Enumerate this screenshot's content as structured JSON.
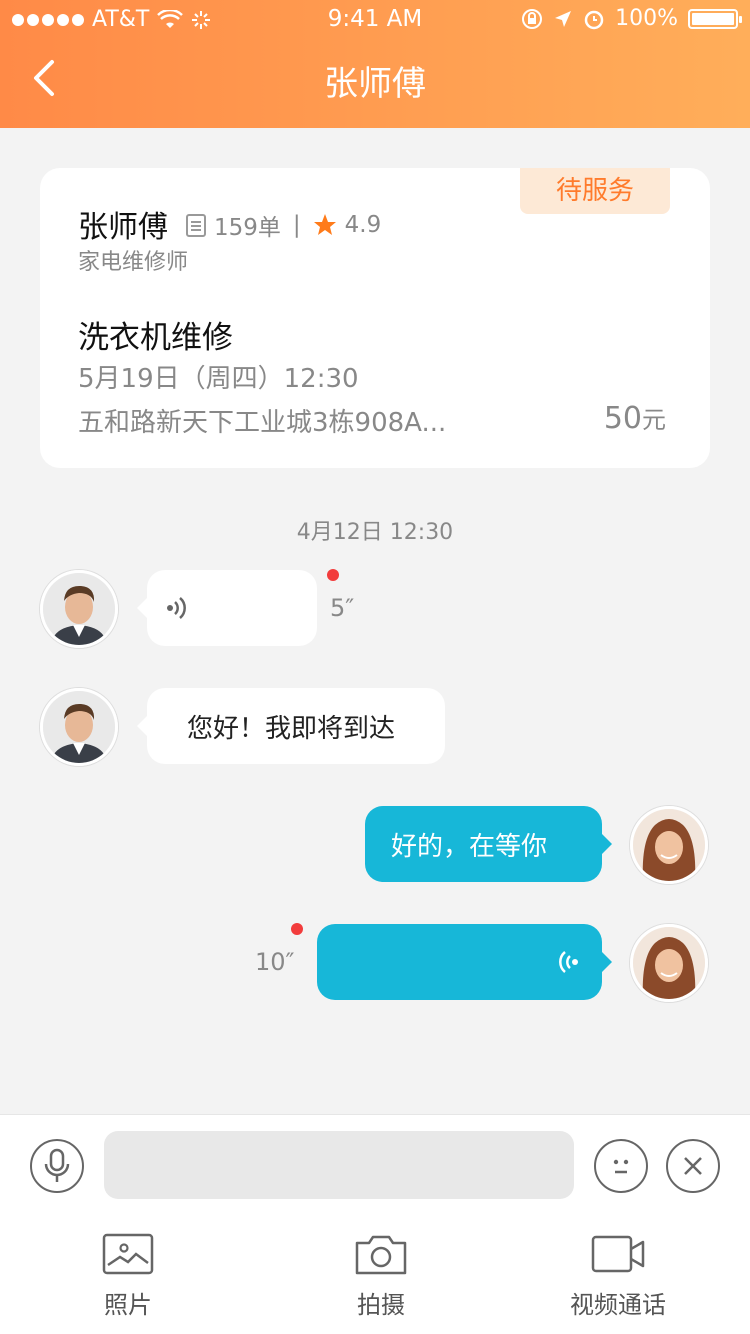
{
  "status_bar": {
    "carrier": "AT&T",
    "time": "9:41 AM",
    "battery": "100%"
  },
  "header": {
    "title": "张师傅"
  },
  "card": {
    "status_tag": "待服务",
    "name": "张师傅",
    "orders": "159单",
    "rating": "4.9",
    "role": "家电维修师",
    "service": "洗衣机维修",
    "datetime": "5月19日（周四）12:30",
    "address": "五和路新天下工业城3栋908A...",
    "price": "50",
    "price_unit": "元"
  },
  "chat": {
    "timestamp": "4月12日 12:30",
    "messages": [
      {
        "side": "left",
        "type": "voice",
        "duration": "5″",
        "unread": true
      },
      {
        "side": "left",
        "type": "text",
        "text": "您好！我即将到达"
      },
      {
        "side": "right",
        "type": "text",
        "text": "好的，在等你"
      },
      {
        "side": "right",
        "type": "voice",
        "duration": "10″",
        "unread": true
      }
    ]
  },
  "toolbar": {
    "photo_label": "照片",
    "camera_label": "拍摄",
    "video_label": "视频通话"
  },
  "colors": {
    "accent": "#ff8a47",
    "bubble": "#17b7d8",
    "tag_bg": "#fde9d6",
    "tag_text": "#ff7b2c",
    "unread_dot": "#f23c3c"
  }
}
